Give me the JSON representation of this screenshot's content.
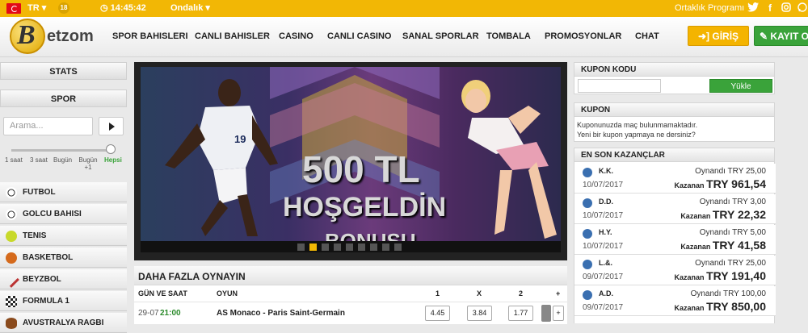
{
  "topbar": {
    "language": "TR",
    "age_badge": "18",
    "time": "14:45:42",
    "odds_format": "Ondalık",
    "partner_label": "Ortaklık Programı"
  },
  "header": {
    "logo_text": "etzom",
    "nav": [
      "SPOR BAHISLERI",
      "CANLI BAHISLER",
      "CASINO",
      "CANLI CASINO",
      "SANAL SPORLAR",
      "TOMBALA",
      "PROMOSYONLAR",
      "CHAT"
    ],
    "login_label": "GİRİŞ",
    "register_label": "KAYIT OL"
  },
  "sidebar": {
    "stats_label": "STATS",
    "spor_label": "SPOR",
    "search_placeholder": "Arama...",
    "time_filters": [
      "1 saat",
      "3 saat",
      "Bugün",
      "Bugün +1",
      "Hepsi"
    ],
    "sports": [
      "FUTBOL",
      "GOLCU BAHISI",
      "TENIS",
      "BASKETBOL",
      "BEYZBOL",
      "FORMULA 1",
      "AVUSTRALYA RAGBI"
    ]
  },
  "banner": {
    "line1": "500 TL",
    "line2": "HOŞGELDİN",
    "line3": "BONUSU",
    "player_number": "19"
  },
  "more_games": {
    "title": "DAHA FAZLA OYNAYIN",
    "columns": {
      "date": "GÜN VE SAAT",
      "game": "OYUN",
      "one": "1",
      "draw": "X",
      "two": "2",
      "plus": "+"
    },
    "rows": [
      {
        "date": "29-07",
        "time": "21:00",
        "match": "AS Monaco - Paris Saint-Germain",
        "odd1": "4.45",
        "oddx": "3.84",
        "odd2": "1.77",
        "more": "+"
      }
    ]
  },
  "coupon_code": {
    "title": "KUPON KODU",
    "load_label": "Yükle"
  },
  "coupon": {
    "title": "KUPON",
    "message_line1": "Kuponunuzda maç bulunmamaktadır.",
    "message_line2": "Yeni bir kupon yapmaya ne dersiniz?"
  },
  "winners": {
    "title": "EN SON KAZANÇLAR",
    "played_label": "Oynandı",
    "won_label": "Kazanan",
    "items": [
      {
        "name": "K.K.",
        "date": "10/07/2017",
        "played": "TRY 25,00",
        "won": "TRY 961,54"
      },
      {
        "name": "D.D.",
        "date": "10/07/2017",
        "played": "TRY 3,00",
        "won": "TRY 22,32"
      },
      {
        "name": "H.Y.",
        "date": "10/07/2017",
        "played": "TRY 5,00",
        "won": "TRY 41,58"
      },
      {
        "name": "L.&.",
        "date": "09/07/2017",
        "played": "TRY 25,00",
        "won": "TRY 191,40"
      },
      {
        "name": "A.D.",
        "date": "09/07/2017",
        "played": "TRY 100,00",
        "won": "TRY 850,00"
      }
    ]
  },
  "colors": {
    "brand_yellow": "#f2b705",
    "login_button": "#f4b400",
    "register_button": "#3aa33a",
    "load_button": "#3aa33a",
    "accent_green": "#3aa33a"
  }
}
